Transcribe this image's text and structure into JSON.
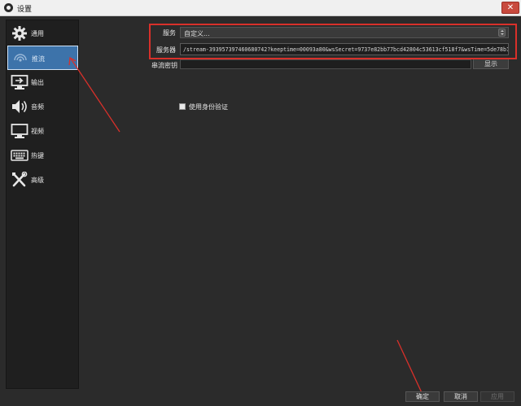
{
  "window": {
    "title": "设置",
    "close_label": "✕"
  },
  "sidebar": {
    "items": [
      {
        "label": "通用",
        "icon": "gear-icon",
        "active": false
      },
      {
        "label": "推流",
        "icon": "stream-icon",
        "active": true
      },
      {
        "label": "输出",
        "icon": "output-icon",
        "active": false
      },
      {
        "label": "音频",
        "icon": "speaker-icon",
        "active": false
      },
      {
        "label": "视频",
        "icon": "monitor-icon",
        "active": false
      },
      {
        "label": "热键",
        "icon": "keyboard-icon",
        "active": false
      },
      {
        "label": "高级",
        "icon": "tools-icon",
        "active": false
      }
    ]
  },
  "stream": {
    "service_label": "服务",
    "service_value": "自定义...",
    "server_label": "服务器",
    "server_value": "/stream-393957397460680742?keeptime=00093a80&wsSecret=9737e82bb77bcd42804c53613cf518f7&wsTime=5de78b11",
    "key_label": "串流密钥",
    "key_value": "",
    "show_label": "显示",
    "auth_label": "使用身份验证",
    "auth_checked": false
  },
  "footer": {
    "ok_label": "确定",
    "cancel_label": "取消",
    "apply_label": "应用"
  },
  "colors": {
    "annotation": "#d9302a",
    "accent": "#3d73aa"
  }
}
